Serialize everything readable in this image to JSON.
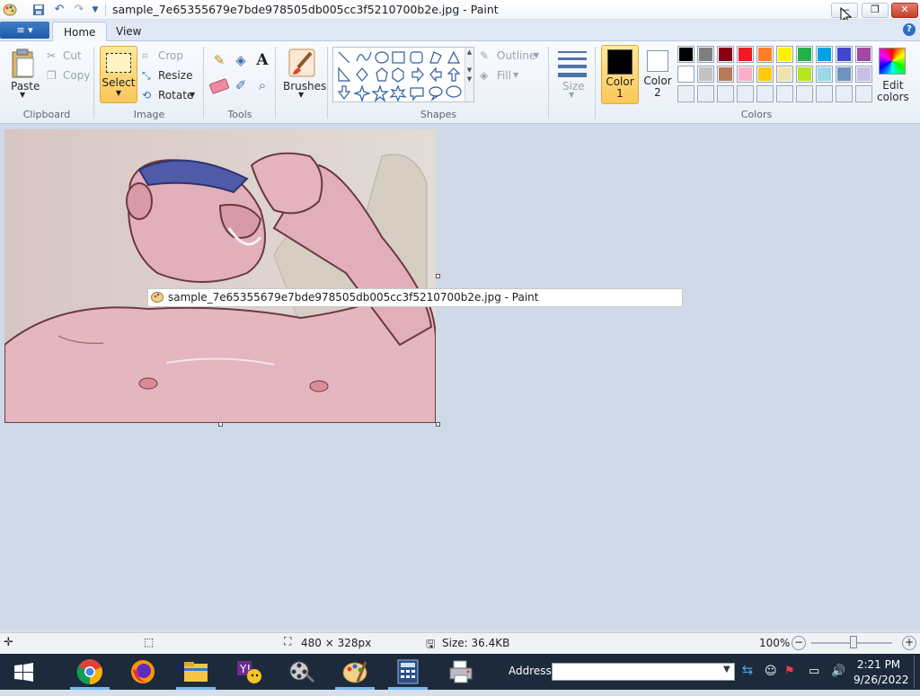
{
  "window": {
    "title": "sample_7e65355679e7bde978505db005cc3f5210700b2e.jpg - Paint",
    "controls": {
      "minimize": "—",
      "restore": "❐",
      "close": "✕"
    }
  },
  "tabs": {
    "file": "≡ ▾",
    "home": "Home",
    "view": "View"
  },
  "ribbon": {
    "clipboard": {
      "paste": "Paste",
      "cut": "Cut",
      "copy": "Copy",
      "group": "Clipboard"
    },
    "image": {
      "select": "Select",
      "crop": "Crop",
      "resize": "Resize",
      "rotate": "Rotate",
      "group": "Image"
    },
    "tools": {
      "group": "Tools",
      "text_tool": "A"
    },
    "brushes": {
      "label": "Brushes"
    },
    "shapes": {
      "outline": "Outline",
      "fill": "Fill",
      "group": "Shapes"
    },
    "size": {
      "label": "Size"
    },
    "colors": {
      "color1": "Color\n1",
      "color1_line1": "Color",
      "color1_line2": "1",
      "color2_line1": "Color",
      "color2_line2": "2",
      "edit_line1": "Edit",
      "edit_line2": "colors",
      "group": "Colors",
      "palette_row1": [
        "#000000",
        "#7f7f7f",
        "#880015",
        "#ed1c24",
        "#ff7f27",
        "#fff200",
        "#22b14c",
        "#00a2e8",
        "#3f48cc",
        "#a349a4"
      ],
      "palette_row2": [
        "#ffffff",
        "#c3c3c3",
        "#b97a57",
        "#ffaec9",
        "#ffc90e",
        "#efe4b0",
        "#b5e61d",
        "#99d9ea",
        "#7092be",
        "#c8bfe7"
      ],
      "color1_value": "#000000",
      "color2_value": "#ffffff"
    }
  },
  "tooltip": {
    "text": "sample_7e65355679e7bde978505db005cc3f5210700b2e.jpg - Paint"
  },
  "status": {
    "dimensions": "480 × 328px",
    "size": "Size: 36.4KB",
    "zoom": "100%",
    "zoom_out": "−",
    "zoom_in": "+"
  },
  "taskbar": {
    "address_label": "Address",
    "time": "2:21 PM",
    "date": "9/26/2022"
  }
}
